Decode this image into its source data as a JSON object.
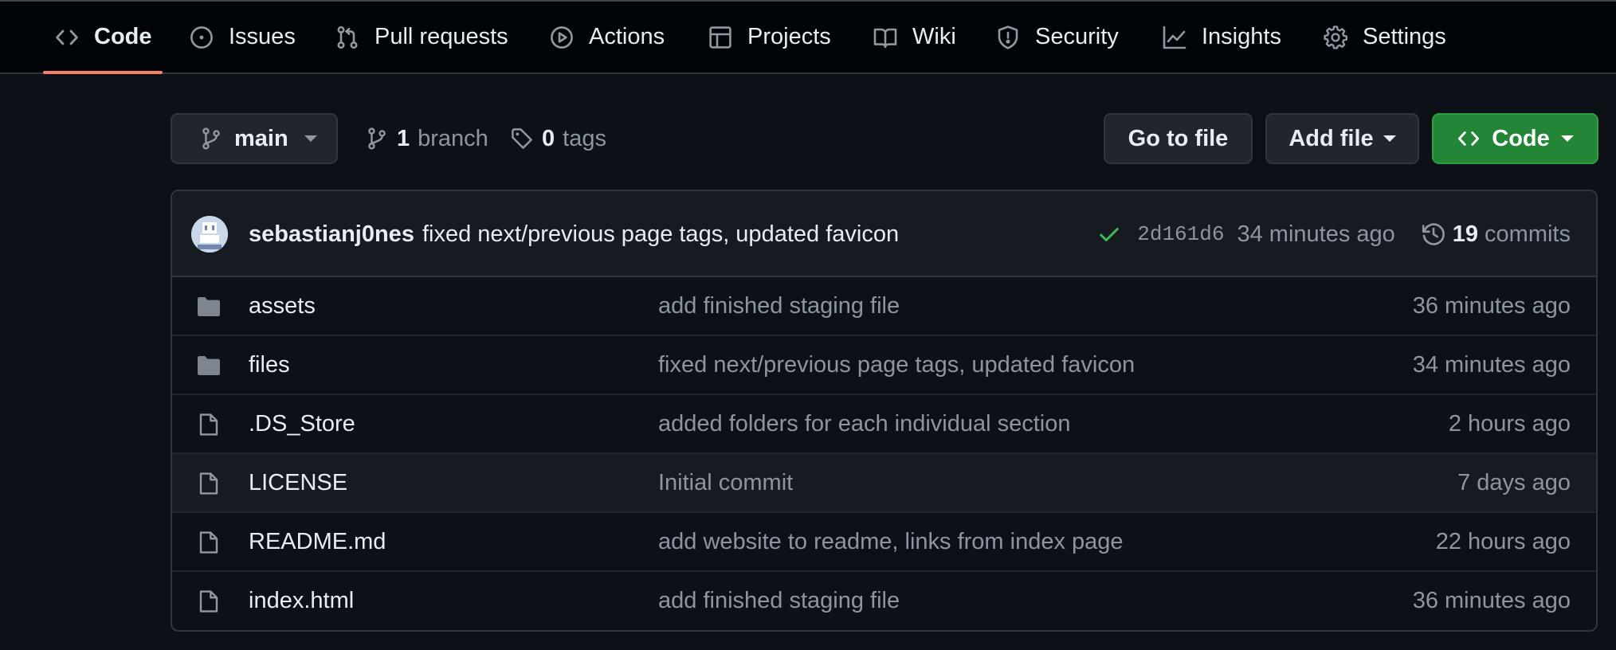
{
  "nav": {
    "tabs": [
      {
        "label": "Code",
        "icon": "code-icon",
        "active": true
      },
      {
        "label": "Issues",
        "icon": "issue-opened-icon"
      },
      {
        "label": "Pull requests",
        "icon": "git-pull-request-icon"
      },
      {
        "label": "Actions",
        "icon": "play-icon"
      },
      {
        "label": "Projects",
        "icon": "table-icon"
      },
      {
        "label": "Wiki",
        "icon": "book-icon"
      },
      {
        "label": "Security",
        "icon": "shield-icon"
      },
      {
        "label": "Insights",
        "icon": "graph-icon"
      },
      {
        "label": "Settings",
        "icon": "gear-icon"
      }
    ]
  },
  "toolbar": {
    "branch_name": "main",
    "branch_count": "1",
    "branch_label": "branch",
    "tag_count": "0",
    "tag_label": "tags",
    "go_to_file": "Go to file",
    "add_file": "Add file",
    "code": "Code"
  },
  "latest_commit": {
    "author": "sebastianj0nes",
    "message": "fixed next/previous page tags, updated favicon",
    "sha": "2d161d6",
    "time": "34 minutes ago",
    "commit_count": "19",
    "commit_label": "commits"
  },
  "files": [
    {
      "name": "assets",
      "type": "folder",
      "message": "add finished staging file",
      "time": "36 minutes ago"
    },
    {
      "name": "files",
      "type": "folder",
      "message": "fixed next/previous page tags, updated favicon",
      "time": "34 minutes ago"
    },
    {
      "name": ".DS_Store",
      "type": "file",
      "message": "added folders for each individual section",
      "time": "2 hours ago"
    },
    {
      "name": "LICENSE",
      "type": "file",
      "message": "Initial commit",
      "time": "7 days ago"
    },
    {
      "name": "README.md",
      "type": "file",
      "message": "add website to readme, links from index page",
      "time": "22 hours ago"
    },
    {
      "name": "index.html",
      "type": "file",
      "message": "add finished staging file",
      "time": "36 minutes ago"
    }
  ],
  "colors": {
    "background": "#0d1117",
    "nav_background": "#010409",
    "border": "#30363d",
    "accent_underline": "#f78166",
    "primary_button": "#238636",
    "success_check": "#3fb950",
    "muted_text": "#8d96a0",
    "folder_icon": "#7d8590"
  }
}
